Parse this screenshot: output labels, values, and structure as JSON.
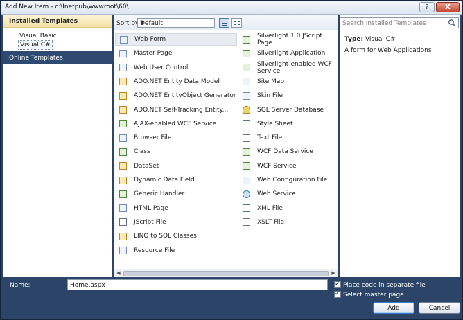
{
  "window": {
    "title": "Add New Item - c:\\Inetpub\\wwwroot\\60\\",
    "help_label": "?",
    "close_label": "X"
  },
  "left": {
    "installed_header": "Installed Templates",
    "items": [
      "Visual Basic",
      "Visual C#"
    ],
    "selected": "Visual C#",
    "online": "Online Templates"
  },
  "toolbar": {
    "sort_label": "Sort by:",
    "sort_value": "Default"
  },
  "templates": {
    "col1": [
      {
        "label": "Web Form",
        "icon": "page"
      },
      {
        "label": "Master Page",
        "icon": "page"
      },
      {
        "label": "Web User Control",
        "icon": "page"
      },
      {
        "label": "ADO.NET Entity Data Model",
        "icon": "data"
      },
      {
        "label": "ADO.NET EntityObject Generator",
        "icon": "data"
      },
      {
        "label": "ADO.NET Self-Tracking Entity...",
        "icon": "data"
      },
      {
        "label": "AJAX-enabled WCF Service",
        "icon": "code"
      },
      {
        "label": "Browser File",
        "icon": "page"
      },
      {
        "label": "Class",
        "icon": "code"
      },
      {
        "label": "DataSet",
        "icon": "data"
      },
      {
        "label": "Dynamic Data Field",
        "icon": "data"
      },
      {
        "label": "Generic Handler",
        "icon": "code"
      },
      {
        "label": "HTML Page",
        "icon": "page"
      },
      {
        "label": "JScript File",
        "icon": "text"
      },
      {
        "label": "LINQ to SQL Classes",
        "icon": "data"
      },
      {
        "label": "Resource File",
        "icon": "page"
      }
    ],
    "col2": [
      {
        "label": "Silverlight 1.0 JScript Page",
        "icon": "code"
      },
      {
        "label": "Silverlight Application",
        "icon": "code"
      },
      {
        "label": "Silverlight-enabled WCF Service",
        "icon": "code"
      },
      {
        "label": "Site Map",
        "icon": "page"
      },
      {
        "label": "Skin File",
        "icon": "page"
      },
      {
        "label": "SQL Server Database",
        "icon": "db"
      },
      {
        "label": "Style Sheet",
        "icon": "text"
      },
      {
        "label": "Text File",
        "icon": "text"
      },
      {
        "label": "WCF Data Service",
        "icon": "code"
      },
      {
        "label": "WCF Service",
        "icon": "code"
      },
      {
        "label": "Web Configuration File",
        "icon": "page"
      },
      {
        "label": "Web Service",
        "icon": "web"
      },
      {
        "label": "XML File",
        "icon": "text"
      },
      {
        "label": "XSLT File",
        "icon": "text"
      }
    ],
    "selected": "Web Form"
  },
  "details": {
    "search_placeholder": "Search Installed Templates",
    "type_label": "Type:",
    "type_value": "Visual C#",
    "description": "A form for Web Applications"
  },
  "bottom": {
    "name_label": "Name:",
    "name_value": "Home.aspx",
    "place_code_label": "Place code in separate file",
    "place_code_checked": true,
    "master_page_label": "Select master page",
    "master_page_checked": true,
    "add_label": "Add",
    "cancel_label": "Cancel"
  }
}
